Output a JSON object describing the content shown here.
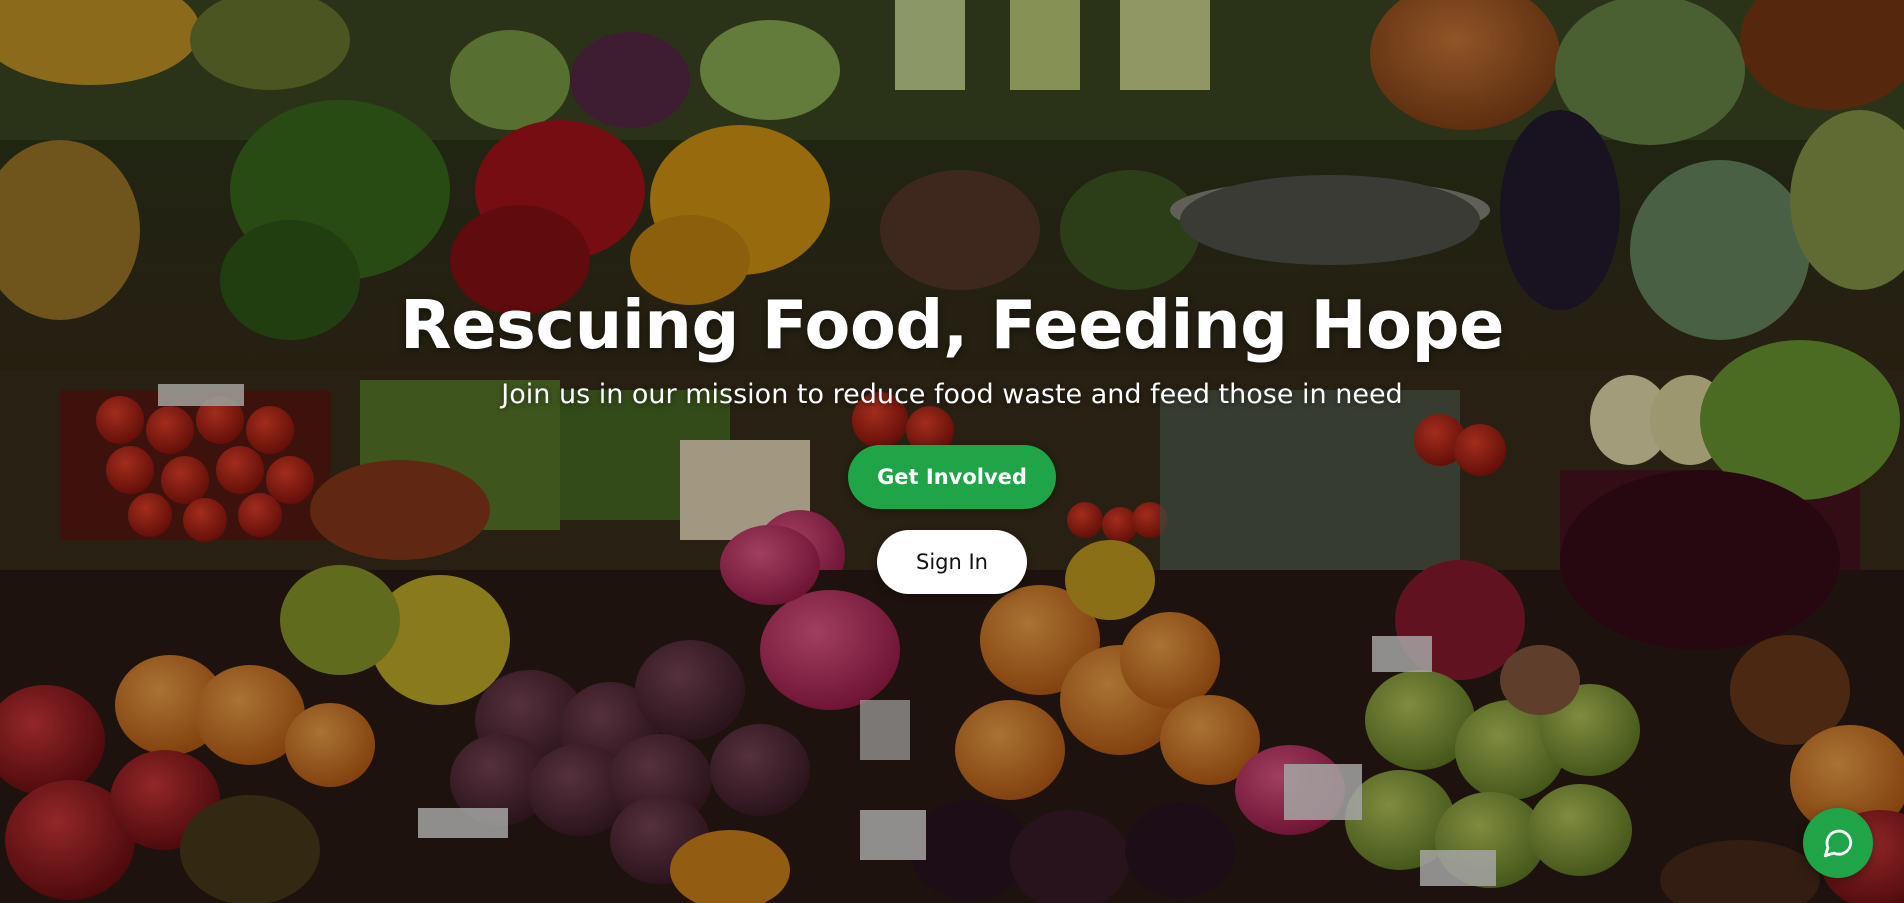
{
  "hero": {
    "title": "Rescuing Food, Feeding Hope",
    "subtitle": "Join us in our mission to reduce food waste and feed those in need",
    "background_icon": "produce-market-photo"
  },
  "actions": {
    "primary_label": "Get Involved",
    "secondary_label": "Sign In"
  },
  "chat": {
    "icon": "chat-bubble-icon"
  },
  "colors": {
    "accent": "#1fa448",
    "text": "#ffffff",
    "secondary_button_bg": "#ffffff",
    "secondary_button_text": "#111111"
  }
}
